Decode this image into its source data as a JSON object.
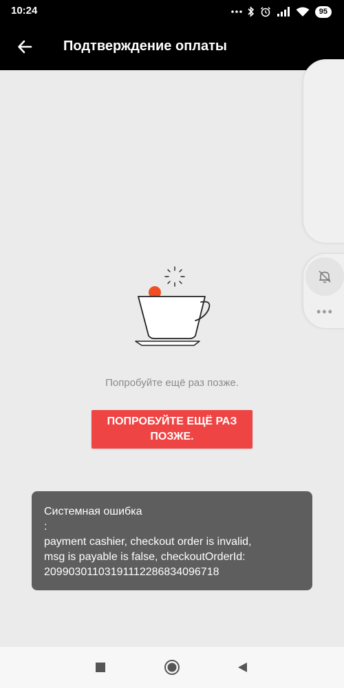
{
  "status_bar": {
    "time": "10:24",
    "battery": "95",
    "icons": [
      "dots-icon",
      "bluetooth-icon",
      "alarm-icon",
      "signal-icon",
      "wifi-icon",
      "battery-icon"
    ]
  },
  "app_bar": {
    "title": "Подтверждение оплаты",
    "back_icon": "arrow-left-icon"
  },
  "empty_state": {
    "illustration": "coffee-cup-icon",
    "message": "Попробуйте ещё раз позже.",
    "retry_line1": "ПОПРОБУЙТЕ ЕЩЁ РАЗ",
    "retry_line2": "ПОЗЖЕ."
  },
  "toast": {
    "line1": "Системная ошибка",
    "line2": ":",
    "line3": "payment cashier, checkout order is invalid,",
    "line4": "msg is  payable is false, checkoutOrderId:",
    "line5": "20990301103191112286834096718"
  },
  "side_panel": {
    "icons": [
      "music-off-icon",
      "bell-off-icon",
      "more-dots-icon"
    ],
    "dots": "•••"
  },
  "nav_bar": {
    "icons": [
      "recents-square-icon",
      "home-circle-icon",
      "back-triangle-icon"
    ]
  },
  "colors": {
    "accent": "#ef4444",
    "cup_dot": "#f04d23",
    "toast_bg": "#5e5e5e",
    "background": "#ebebeb"
  }
}
